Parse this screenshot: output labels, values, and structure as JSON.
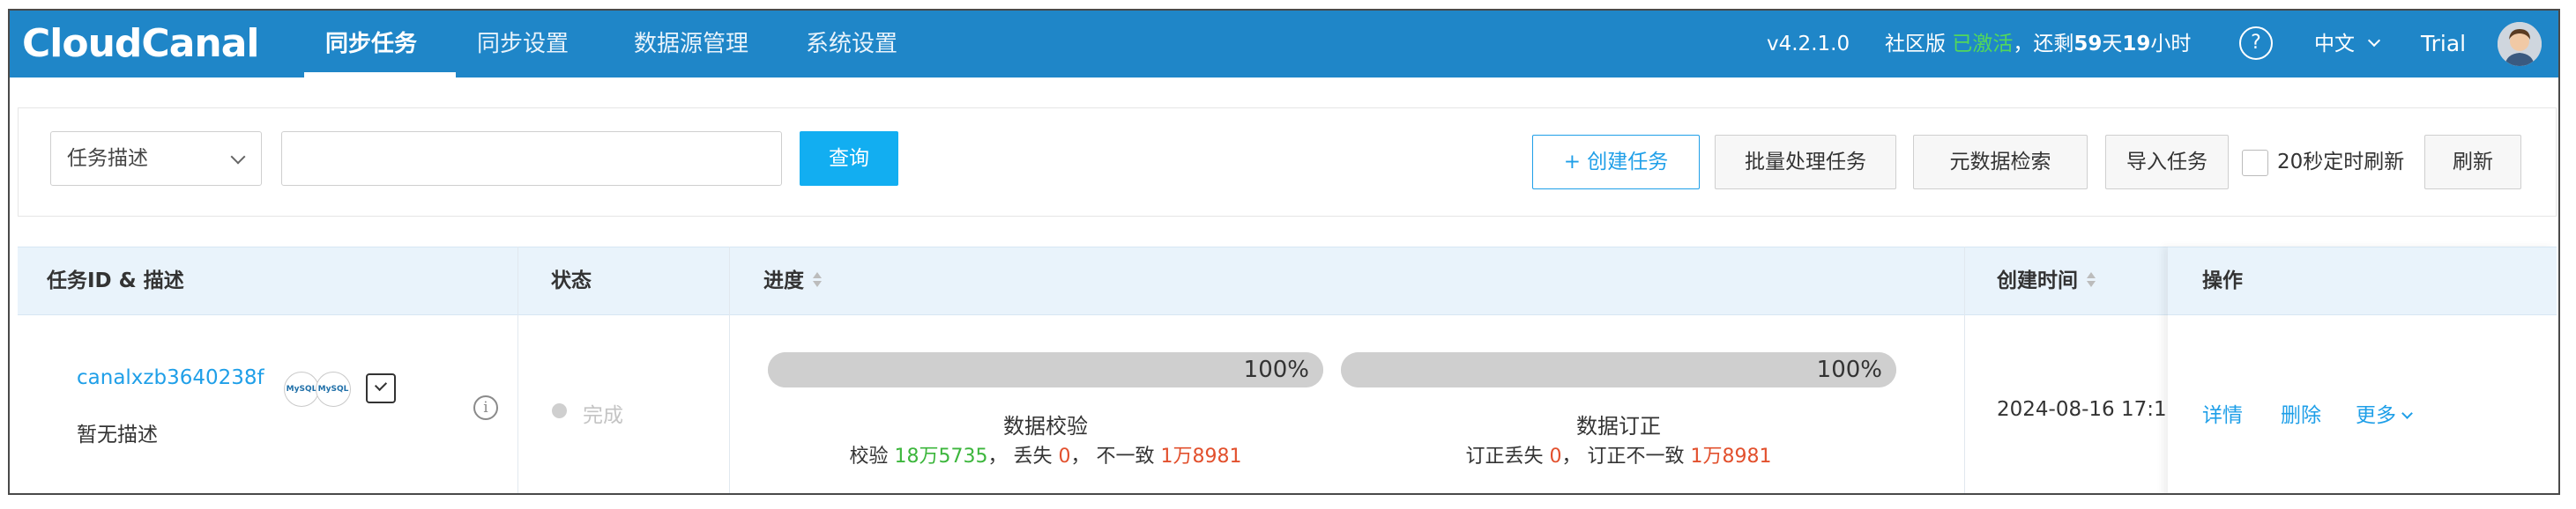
{
  "app": {
    "logo": "CloudCanal",
    "nav": [
      "同步任务",
      "同步设置",
      "数据源管理",
      "系统设置"
    ],
    "version": "v4.2.1.0",
    "edition": "社区版",
    "activation": "已激活",
    "remaining_prefix": "，还剩",
    "remaining_days": "59",
    "days_unit": "天",
    "remaining_hours": "19",
    "hours_unit": "小时",
    "help": "?",
    "language": "中文",
    "user": "Trial"
  },
  "toolbar": {
    "filter_select": "任务描述",
    "search_value": "",
    "query": "查询",
    "create": "+ 创建任务",
    "batch": "批量处理任务",
    "metadata": "元数据检索",
    "import": "导入任务",
    "auto_refresh": "20秒定时刷新",
    "refresh": "刷新"
  },
  "table": {
    "headers": {
      "id": "任务ID & 描述",
      "status": "状态",
      "progress": "进度",
      "created": "创建时间",
      "ops": "操作"
    },
    "row": {
      "task_id": "canalxzb3640238f",
      "desc": "暂无描述",
      "db_source": "MySQL",
      "db_target": "MySQL",
      "info": "i",
      "status": "完成",
      "progress": [
        {
          "percent": 100,
          "percent_label": "100%",
          "title": "数据校验",
          "detail": [
            {
              "text": "校验 ",
              "tone": "plain"
            },
            {
              "text": "18万5735",
              "tone": "green"
            },
            {
              "text": "， 丢失 ",
              "tone": "plain"
            },
            {
              "text": "0",
              "tone": "red"
            },
            {
              "text": "， 不一致 ",
              "tone": "plain"
            },
            {
              "text": "1万8981",
              "tone": "red"
            }
          ]
        },
        {
          "percent": 100,
          "percent_label": "100%",
          "title": "数据订正",
          "detail": [
            {
              "text": "订正丢失 ",
              "tone": "plain"
            },
            {
              "text": "0",
              "tone": "red"
            },
            {
              "text": "， 订正不一致 ",
              "tone": "plain"
            },
            {
              "text": "1万8981",
              "tone": "red"
            }
          ]
        }
      ],
      "created_time": "2024-08-16 17:1",
      "ops": {
        "detail": "详情",
        "delete": "删除",
        "more": "更多"
      }
    }
  },
  "colors": {
    "nav_bg": "#1f86c8",
    "accent": "#1f9fe8",
    "query_btn": "#12aef1",
    "green": "#3cb63c",
    "red": "#e2502d"
  }
}
